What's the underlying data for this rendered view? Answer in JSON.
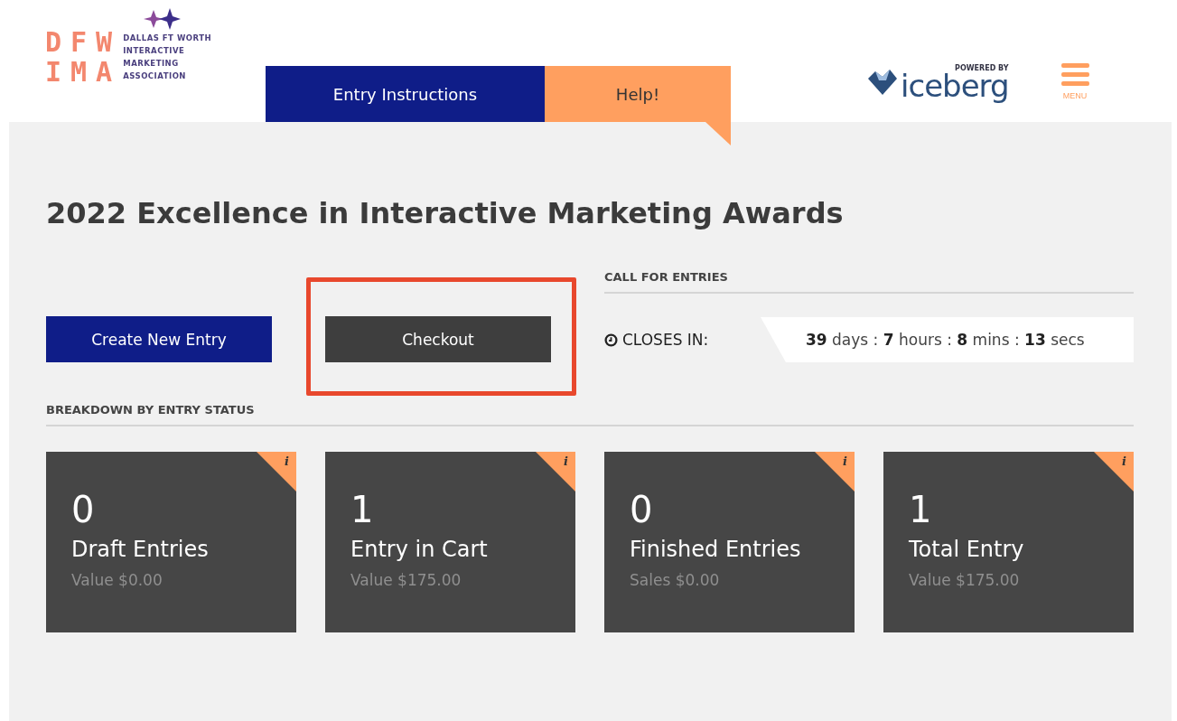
{
  "logo": {
    "mark_lines": [
      "DFW",
      "IMA"
    ],
    "text_lines": [
      "DALLAS FT WORTH",
      "INTERACTIVE",
      "MARKETING",
      "ASSOCIATION"
    ]
  },
  "nav": [
    {
      "label": "Entry Instructions",
      "kind": "primary"
    },
    {
      "label": "Help!",
      "kind": "accent"
    }
  ],
  "powered": {
    "caption": "POWERED BY",
    "brand": "iceberg"
  },
  "menu": {
    "label": "MENU"
  },
  "title": "2022 Excellence in Interactive Marketing Awards",
  "actions": [
    {
      "label": "Create New Entry",
      "kind": "primary",
      "highlighted": false
    },
    {
      "label": "Checkout",
      "kind": "dark",
      "highlighted": true
    }
  ],
  "call_for_entries": {
    "heading": "CALL FOR ENTRIES",
    "closes_label": "CLOSES IN:",
    "countdown": [
      {
        "number": "39",
        "unit": "days"
      },
      {
        "number": "7",
        "unit": "hours"
      },
      {
        "number": "8",
        "unit": "mins"
      },
      {
        "number": "13",
        "unit": "secs"
      }
    ],
    "separator": ":"
  },
  "breakdown": {
    "heading": "BREAKDOWN BY ENTRY STATUS",
    "cards": [
      {
        "count": "0",
        "label": "Draft Entries",
        "detail": "Value $0.00",
        "info_glyph": "i"
      },
      {
        "count": "1",
        "label": "Entry in Cart",
        "detail": "Value $175.00",
        "info_glyph": "i"
      },
      {
        "count": "0",
        "label": "Finished Entries",
        "detail": "Sales $0.00",
        "info_glyph": "i"
      },
      {
        "count": "1",
        "label": "Total Entry",
        "detail": "Value $175.00",
        "info_glyph": "i"
      }
    ]
  }
}
